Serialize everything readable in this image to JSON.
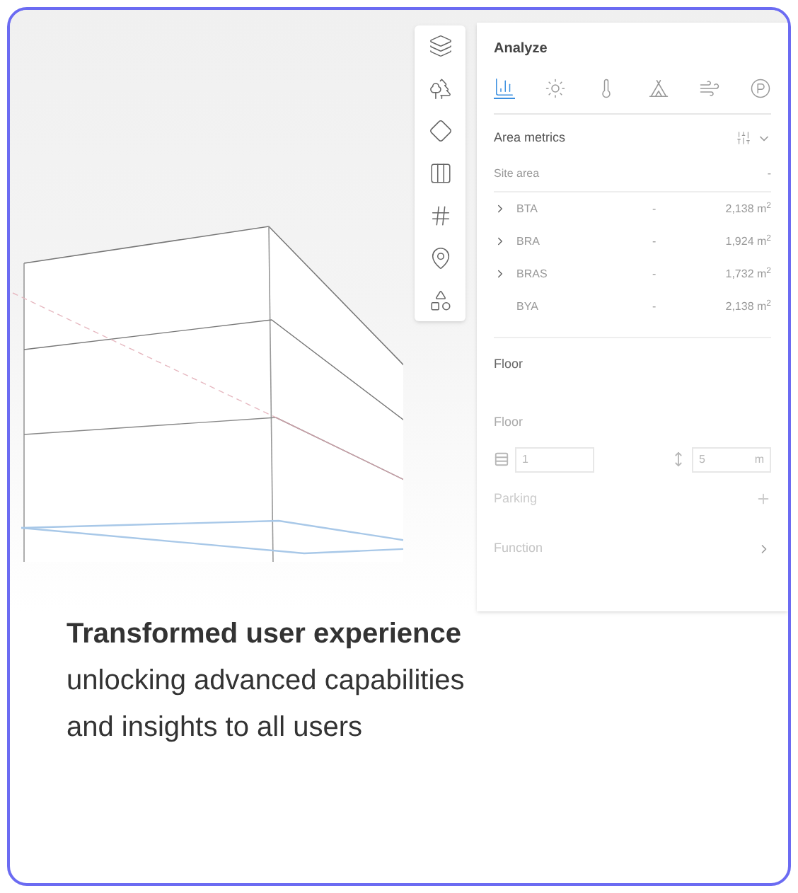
{
  "panel": {
    "title": "Analyze",
    "tools": [
      {
        "selected": true
      },
      {
        "selected": false
      },
      {
        "selected": false
      },
      {
        "selected": false
      },
      {
        "selected": false
      },
      {
        "selected": false
      }
    ],
    "section": "Area metrics",
    "site_area": {
      "label": "Site area",
      "value": "-"
    },
    "metrics": [
      {
        "label": "BTA",
        "dash": "-",
        "value": "2,138 m$^{2}$",
        "expandable": true
      },
      {
        "label": "BRA",
        "dash": "-",
        "value": "1,924 m$^{2}$",
        "expandable": true
      },
      {
        "label": "BRAS",
        "dash": "-",
        "value": "1,732 m$^{2}$",
        "expandable": true
      },
      {
        "label": "BYA",
        "dash": "-",
        "value": "2,138 m$^{2}$",
        "expandable": false
      }
    ],
    "floor_section": "Floor",
    "floor_label": "Floor",
    "floors_value": "1",
    "height_value": "5",
    "height_unit": "m",
    "parking": "Parking",
    "function": "Function"
  },
  "caption": {
    "heading": "Transformed user experience",
    "body": "unlocking advanced capabilities and insights to all users"
  }
}
